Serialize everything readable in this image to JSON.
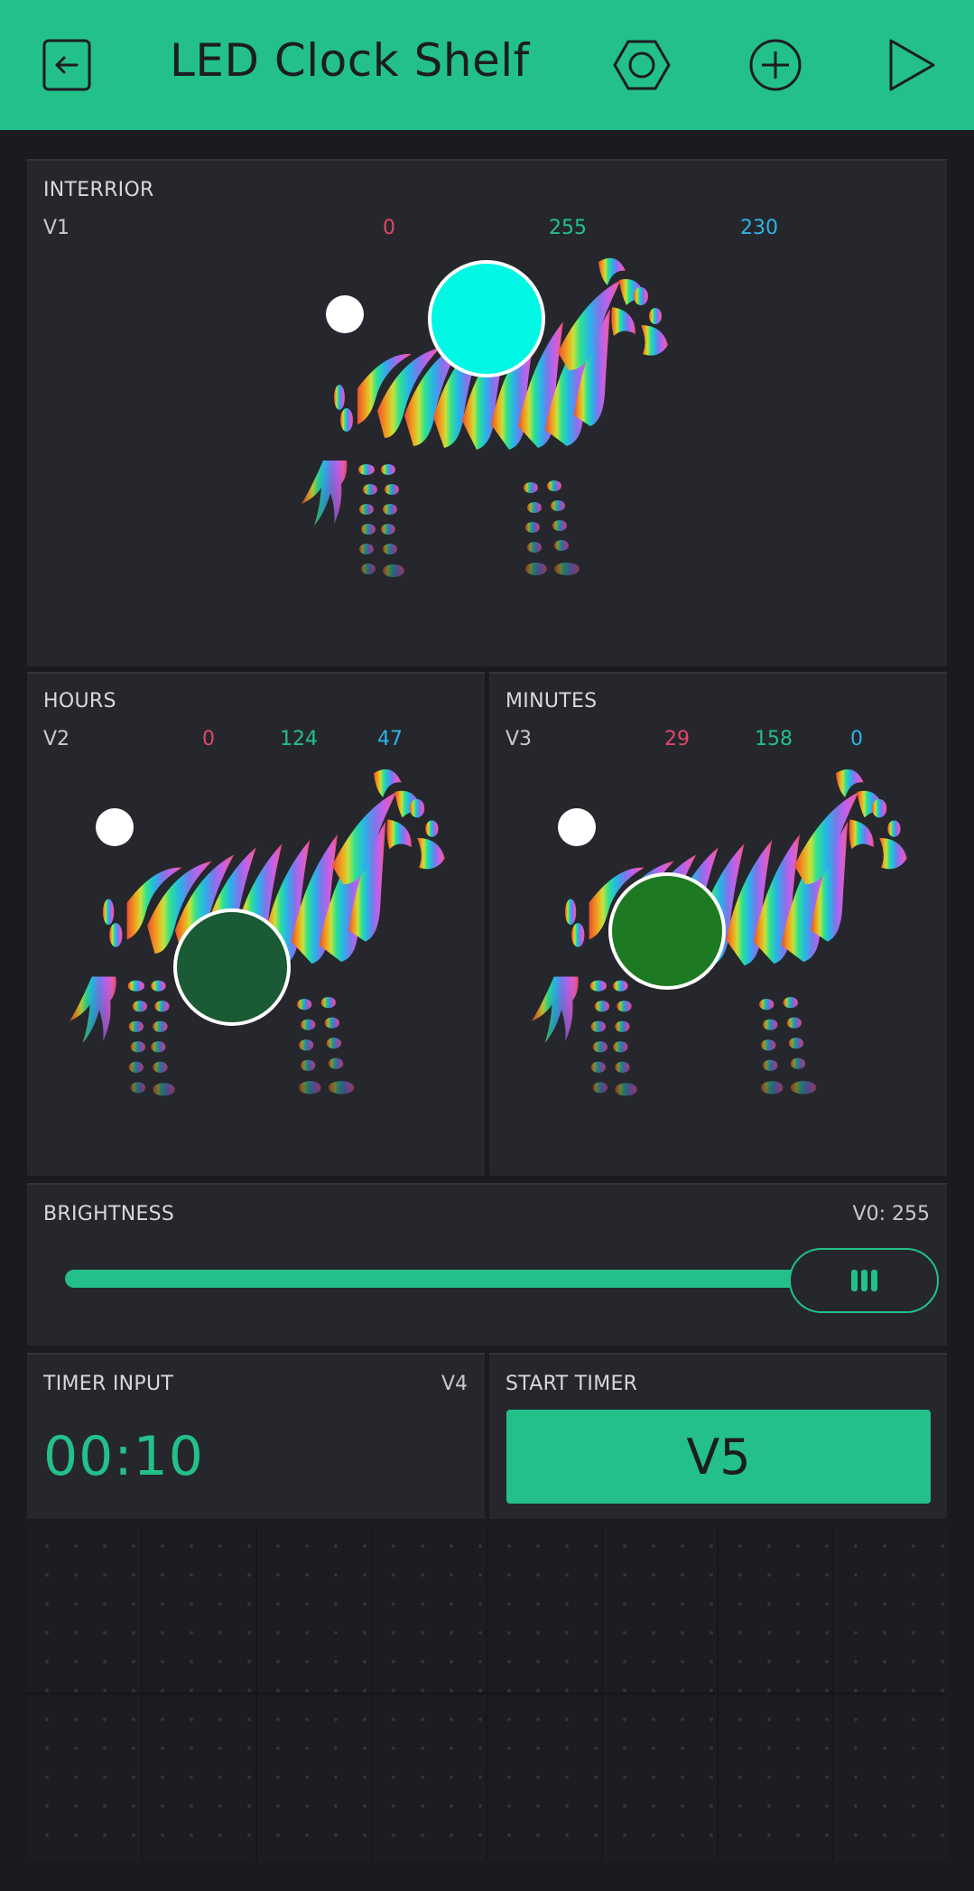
{
  "appbar": {
    "title": "LED Clock Shelf",
    "icons": [
      "exit-icon",
      "settings-icon",
      "add-icon",
      "play-icon"
    ]
  },
  "colors": {
    "accent": "#23c08a",
    "red_value": "#e2466b",
    "green_value": "#23c08a",
    "blue_value": "#2fb3e8",
    "background": "#1a1b1f",
    "panel": "#26272c"
  },
  "interior": {
    "label": "INTERRIOR",
    "pin": "V1",
    "r": "0",
    "g": "255",
    "b": "230",
    "selected_color": "#00f7e4"
  },
  "hours": {
    "label": "HOURS",
    "pin": "V2",
    "r": "0",
    "g": "124",
    "b": "47",
    "selected_color": "#1a5a34"
  },
  "minutes": {
    "label": "MINUTES",
    "pin": "V3",
    "r": "29",
    "g": "158",
    "b": "0",
    "selected_color": "#1e7a22"
  },
  "brightness": {
    "label": "BRIGHTNESS",
    "pin_value": "V0: 255",
    "level": 1.0
  },
  "timer_input": {
    "label": "TIMER INPUT",
    "pin": "V4",
    "value": "00:10"
  },
  "start_timer": {
    "label": "START TIMER",
    "button_label": "V5"
  }
}
